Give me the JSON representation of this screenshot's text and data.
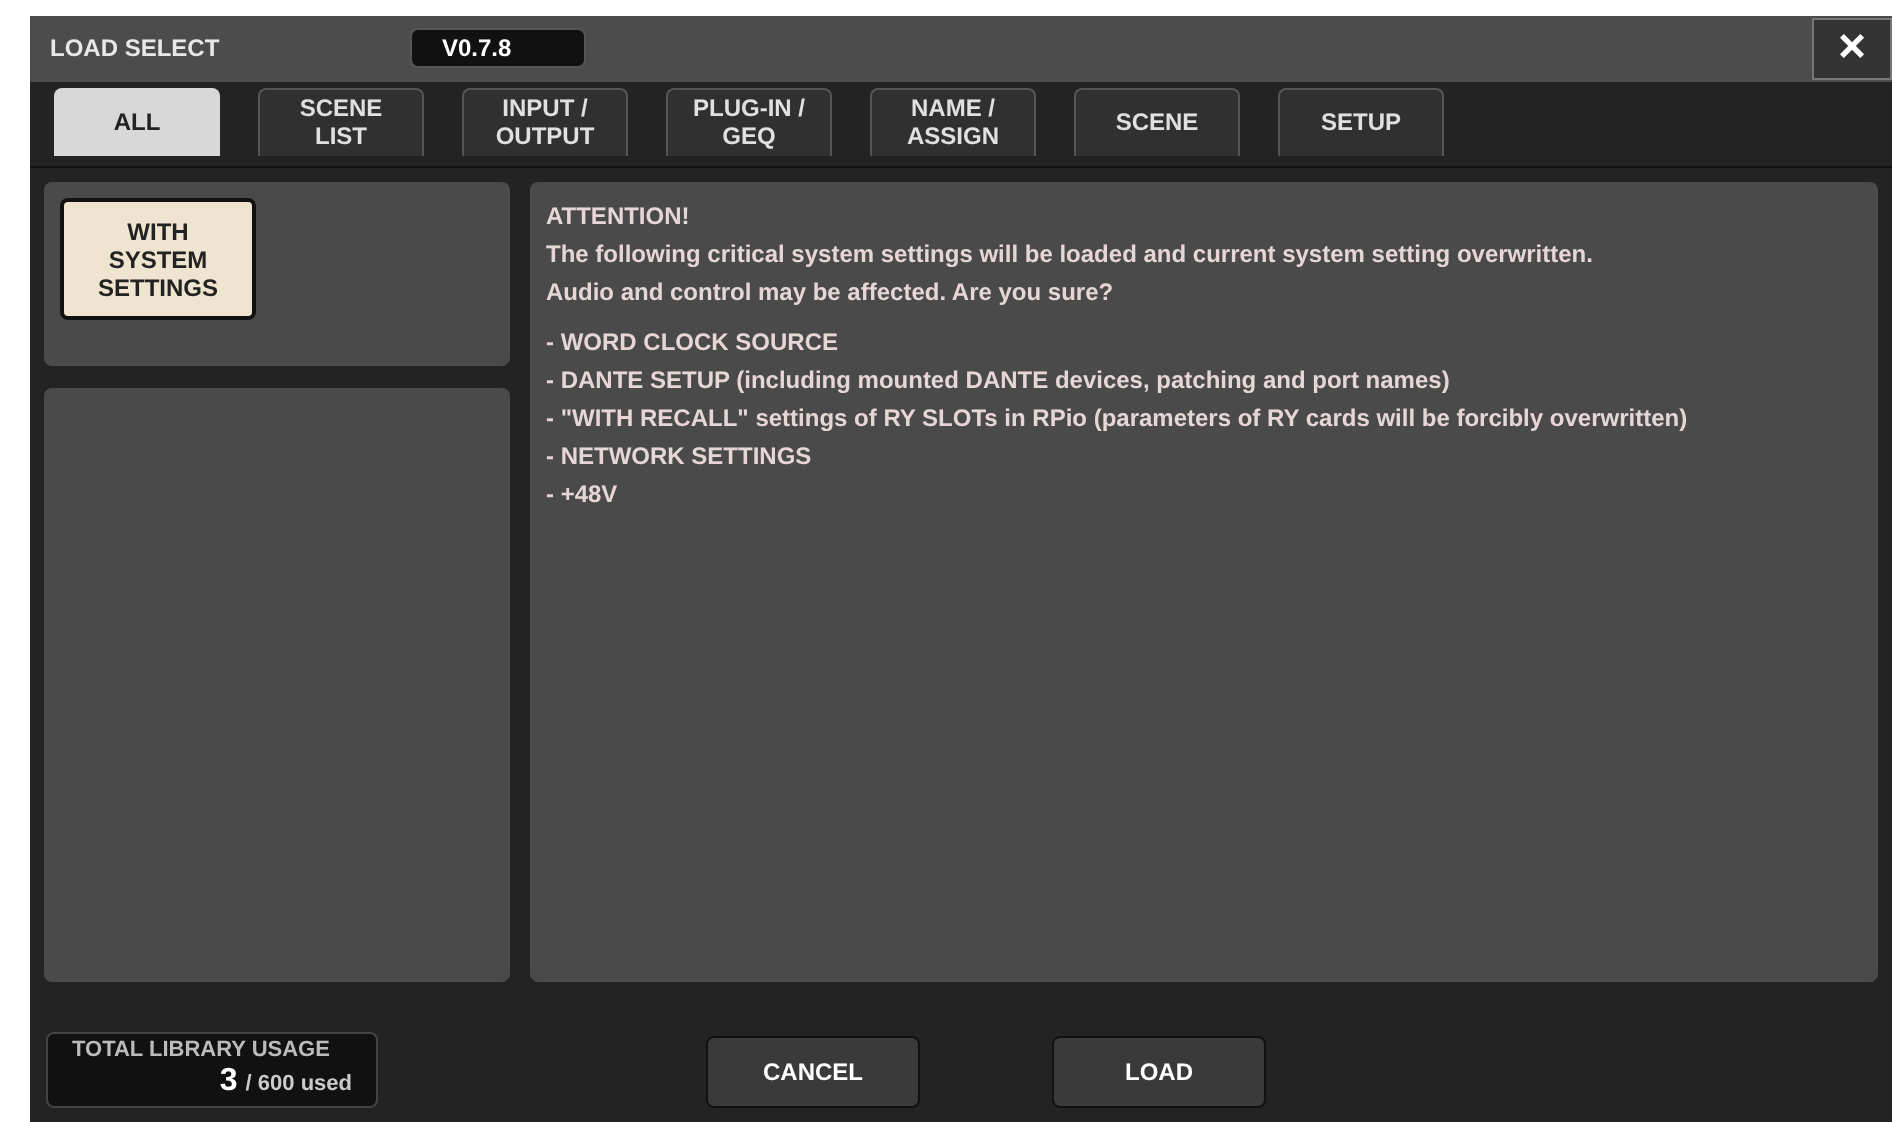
{
  "window": {
    "title": "LOAD SELECT",
    "version": "V0.7.8",
    "close": "×"
  },
  "tabs": [
    {
      "label": "ALL",
      "selected": true
    },
    {
      "label": "SCENE\nLIST",
      "selected": false
    },
    {
      "label": "INPUT /\nOUTPUT",
      "selected": false
    },
    {
      "label": "PLUG-IN /\nGEQ",
      "selected": false
    },
    {
      "label": "NAME /\nASSIGN",
      "selected": false
    },
    {
      "label": "SCENE",
      "selected": false
    },
    {
      "label": "SETUP",
      "selected": false
    }
  ],
  "option_button": {
    "label": "WITH\nSYSTEM\nSETTINGS",
    "on": true
  },
  "message": {
    "heading": "ATTENTION!",
    "lines": [
      "The following critical system settings will be loaded and current system setting overwritten.",
      "Audio and control may be affected. Are you sure?"
    ],
    "items": [
      "- WORD CLOCK SOURCE",
      "- DANTE SETUP (including mounted DANTE devices, patching and port names)",
      "- \"WITH RECALL\" settings of RY SLOTs in RPio (parameters of RY cards will be forcibly overwritten)",
      "- NETWORK SETTINGS",
      "- +48V"
    ]
  },
  "usage": {
    "label": "TOTAL LIBRARY USAGE",
    "count": "3",
    "total": "/ 600 used"
  },
  "buttons": [
    "CANCEL",
    "LOAD"
  ]
}
